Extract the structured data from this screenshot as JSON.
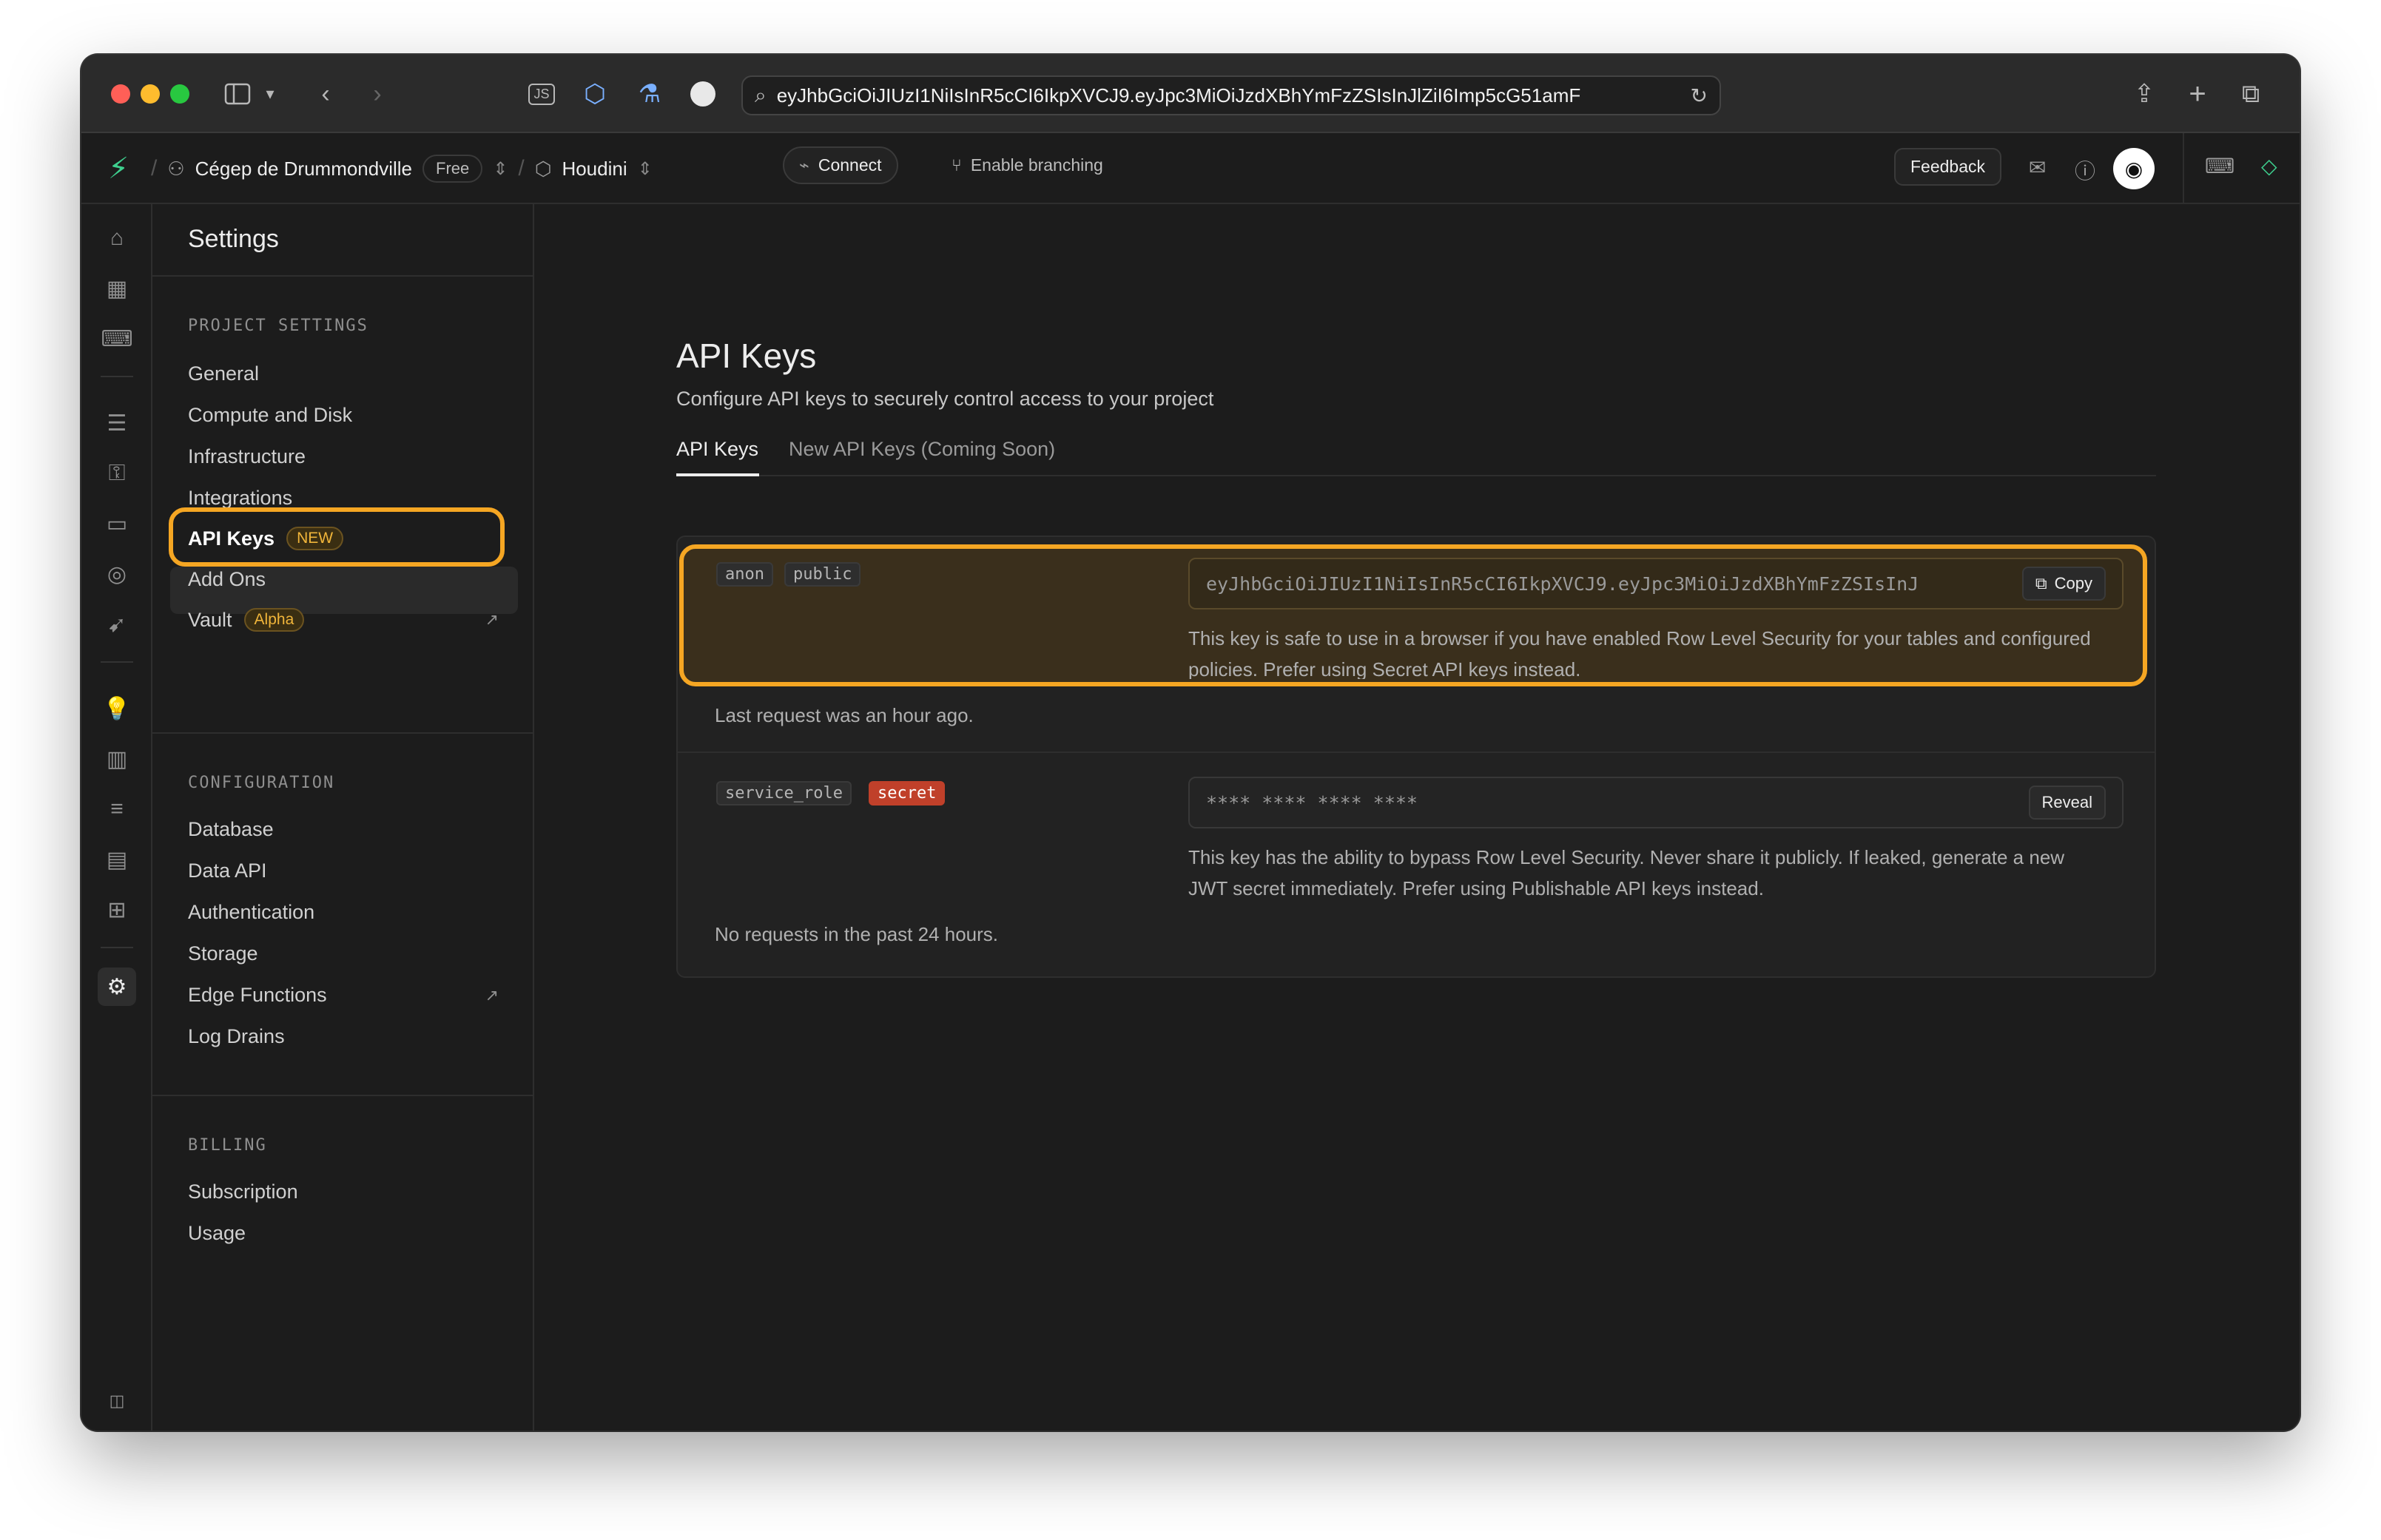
{
  "browser": {
    "url": "eyJhbGciOiJIUzI1NiIsInR5cCI6IkpXVCJ9.eyJpc3MiOiJzdXBhYmFzZSIsInJlZiI6Imp5cG51amF",
    "js_label": "JS"
  },
  "header": {
    "org_name": "Cégep de Drummondville",
    "plan_badge": "Free",
    "project_name": "Houdini",
    "connect_label": "Connect",
    "branching_label": "Enable branching",
    "feedback_label": "Feedback"
  },
  "sidebar": {
    "title": "Settings",
    "sections": {
      "project_settings": {
        "label": "PROJECT SETTINGS",
        "items": [
          "General",
          "Compute and Disk",
          "Infrastructure",
          "Integrations",
          "API Keys",
          "Add Ons",
          "Vault"
        ],
        "api_keys_badge": "NEW",
        "vault_badge": "Alpha"
      },
      "configuration": {
        "label": "CONFIGURATION",
        "items": [
          "Database",
          "Data API",
          "Authentication",
          "Storage",
          "Edge Functions",
          "Log Drains"
        ]
      },
      "billing": {
        "label": "BILLING",
        "items": [
          "Subscription",
          "Usage"
        ]
      }
    }
  },
  "main": {
    "title": "API Keys",
    "subtitle": "Configure API keys to securely control access to your project",
    "tabs": [
      "API Keys",
      "New API Keys (Coming Soon)"
    ],
    "keys": [
      {
        "name_chip": "anon",
        "type_chip": "public",
        "value": "eyJhbGciOiJIUzI1NiIsInR5cCI6IkpXVCJ9.eyJpc3MiOiJzdXBhYmFzZSIsInJ",
        "button": "Copy",
        "description": "This key is safe to use in a browser if you have enabled Row Level Security for your tables and configured policies. Prefer using Secret API keys instead.",
        "last_request": "Last request was an hour ago."
      },
      {
        "name_chip": "service_role",
        "type_chip": "secret",
        "value": "**** **** **** ****",
        "button": "Reveal",
        "description": "This key has the ability to bypass Row Level Security. Never share it publicly. If leaked, generate a new JWT secret immediately. Prefer using Publishable API keys instead.",
        "last_request": "No requests in the past 24 hours."
      }
    ]
  },
  "colors": {
    "highlight": "#f5a623",
    "brand": "#3ecf8e",
    "secret_chip": "#c0402a"
  },
  "icons": {
    "rail": [
      "home-icon",
      "table-editor-icon",
      "sql-editor-icon",
      "database-icon",
      "auth-lock-icon",
      "storage-icon",
      "realtime-icon",
      "edge-functions-icon",
      "advisors-icon",
      "reports-icon",
      "logs-icon",
      "api-docs-icon",
      "integrations-icon",
      "settings-gear-icon",
      "collapse-sidebar-icon"
    ]
  }
}
